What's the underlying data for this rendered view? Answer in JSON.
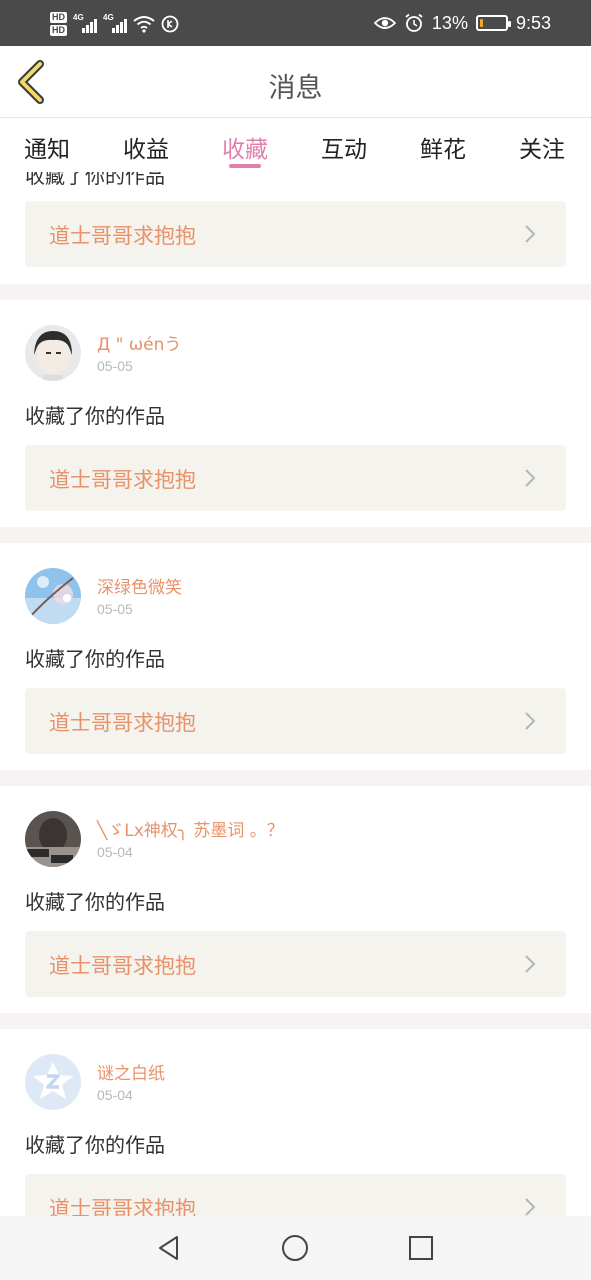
{
  "status_bar": {
    "hd1": "HD",
    "hd2": "HD",
    "sim1": "4G",
    "sim2": "4G",
    "battery_level": 0.13,
    "battery_text": "13%",
    "time": "9:53"
  },
  "header": {
    "title": "消息"
  },
  "tabs": [
    {
      "label": "通知",
      "active": false
    },
    {
      "label": "收益",
      "active": false
    },
    {
      "label": "收藏",
      "active": true
    },
    {
      "label": "互动",
      "active": false
    },
    {
      "label": "鲜花",
      "active": false
    },
    {
      "label": "关注",
      "active": false
    }
  ],
  "feed": {
    "partial_action": "收藏了你的作品",
    "partial_work": "道士哥哥求抱抱",
    "items": [
      {
        "name": "Д \" ωénう",
        "date": "05-05",
        "action": "收藏了你的作品",
        "work": "道士哥哥求抱抱"
      },
      {
        "name": "深绿色微笑",
        "date": "05-05",
        "action": "收藏了你的作品",
        "work": "道士哥哥求抱抱"
      },
      {
        "name": "╲ゞLx神权╮ 苏墨词 。？",
        "date": "05-04",
        "action": "收藏了你的作品",
        "work": "道士哥哥求抱抱"
      },
      {
        "name": "谜之白纸",
        "date": "05-04",
        "action": "收藏了你的作品",
        "work": "道士哥哥求抱抱"
      }
    ]
  },
  "colors": {
    "accent": "#e37fae",
    "name": "#e8926b",
    "status_bar": "#4a4a4a"
  }
}
